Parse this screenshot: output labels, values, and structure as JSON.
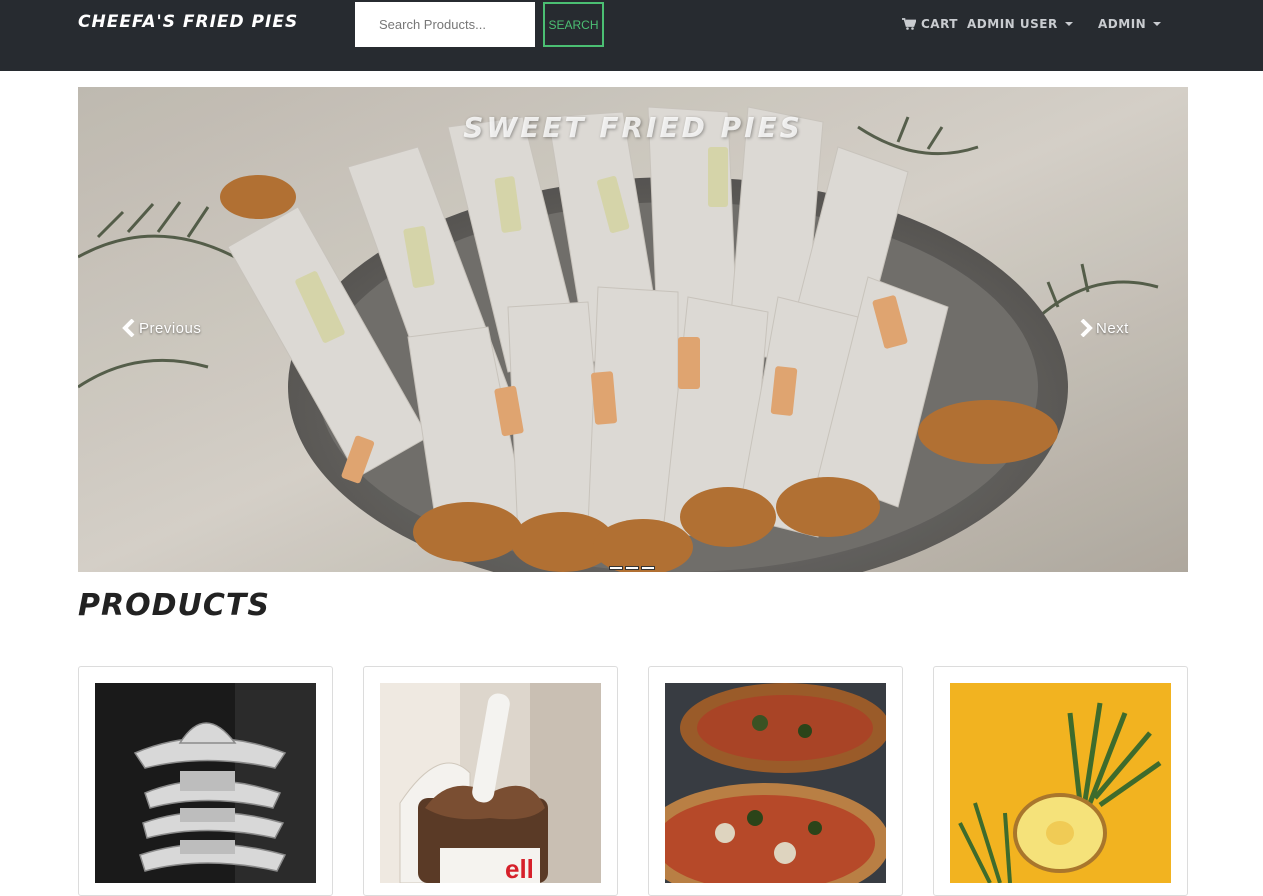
{
  "navbar": {
    "brand": "Cheefa's Fried Pies",
    "search": {
      "placeholder": "Search Products...",
      "value": "",
      "button_label": "Search"
    },
    "cart_label": "Cart",
    "cart_icon": "shopping-cart-icon",
    "user_menu_label": "Admin User",
    "admin_menu_label": "Admin"
  },
  "carousel": {
    "caption": "Sweet Fried Pies",
    "prev_label": "Previous",
    "next_label": "Next",
    "indicator_count": 3,
    "active_index": 0
  },
  "products": {
    "title": "Products",
    "items": [
      {
        "image_alt": "stacked cowboy hats"
      },
      {
        "image_alt": "nutella jar with spoon"
      },
      {
        "image_alt": "pizza"
      },
      {
        "image_alt": "halved pineapple on yellow"
      }
    ]
  },
  "colors": {
    "navbar_bg": "#272b30",
    "accent_green": "#4bbf73",
    "title_text": "#222222"
  }
}
